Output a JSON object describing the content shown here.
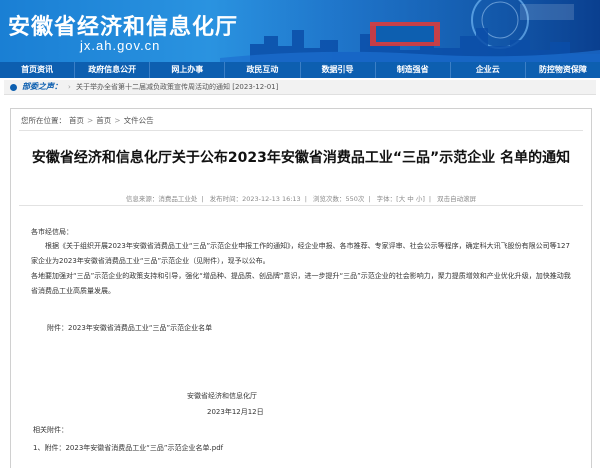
{
  "banner": {
    "title": "安徽省经济和信息化厅",
    "domain": "jx.ah.gov.cn"
  },
  "nav": {
    "items": [
      "首页资讯",
      "政府信息公开",
      "网上办事",
      "政民互动",
      "数据引导",
      "制造强省",
      "企业云",
      "防控物资保障"
    ]
  },
  "notice": {
    "label": "部委之声：",
    "text": "关于举办全省第十二届减负政策宣传周活动的通知 [2023-12-01]"
  },
  "breadcrumb": {
    "prefix": "您所在位置：",
    "items": [
      "首页",
      "首页",
      "文件公告"
    ],
    "separator": ">"
  },
  "article": {
    "title": "安徽省经济和信息化厅关于公布2023年安徽省消费品工业“三品”示范企业 名单的通知",
    "meta": {
      "source": "信息来源：消费品工业处",
      "date": "发布时间：2023-12-13 16:13",
      "views": "浏览次数：550次",
      "font_size": "字体：[大 中 小]",
      "auto_scroll": "双击自动滚屏"
    },
    "salutation": "各市经信局：",
    "para1": "根据《关于组织开展2023年安徽省消费品工业“三品”示范企业申报工作的通知》，经企业申报、各市推荐、专家评审、社会公示等程序，确定科大讯飞股份有限公司等127家企业为2023年安徽省消费品工业“三品”示范企业（见附件），现予以公布。",
    "para2": "各地要加强对“三品”示范企业的政策支持和引导，强化“增品种、提品质、创品牌”意识，进一步提升“三品”示范企业的社会影响力，聚力提质增效和产业优化升级，加快推动我省消费品工业高质量发展。",
    "attachment_note": "附件：2023年安徽省消费品工业“三品”示范企业名单",
    "signature": "安徽省经济和信息化厅",
    "sign_date": "2023年12月12日",
    "attachments_heading": "相关附件：",
    "attachment_link": "1、附件：2023年安徽省消费品工业“三品”示范企业名单.pdf"
  },
  "colors": {
    "brand_blue": "#0d5fb0",
    "banner_blue": "#1a7fd4"
  }
}
